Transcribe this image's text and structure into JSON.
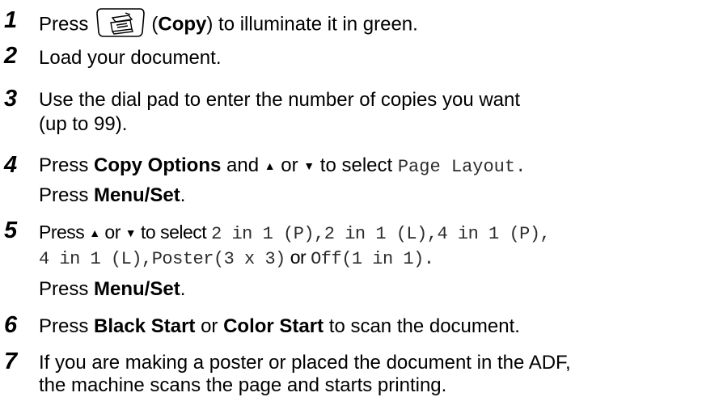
{
  "steps": [
    {
      "number": "1",
      "parts": [
        "Press",
        "(",
        "Copy",
        ") to illuminate it in green."
      ],
      "icon": "copy-key-icon"
    },
    {
      "number": "2",
      "text": "Load your document."
    },
    {
      "number": "3",
      "line1": "Use the dial pad to enter the number of copies you want",
      "line2": "(up to 99)."
    },
    {
      "number": "4",
      "line1_parts": [
        "Press ",
        "Copy Options",
        " and ",
        "▲",
        " or ",
        "▼",
        " to select ",
        "Page Layout",
        "."
      ],
      "line2_parts": [
        "Press ",
        "Menu/Set",
        "."
      ]
    },
    {
      "number": "5",
      "line1_parts": [
        "Press ",
        "▲",
        " or ",
        "▼",
        " to select ",
        "2 in 1 (P),2 in 1 (L),4 in 1 (P),"
      ],
      "line2_parts": [
        "4 in 1 (L),Poster(3 x 3)",
        " or ",
        "Off(1 in 1)",
        "."
      ],
      "line3_parts": [
        "Press ",
        "Menu/Set",
        "."
      ]
    },
    {
      "number": "6",
      "parts": [
        "Press ",
        "Black Start",
        " or ",
        "Color Start",
        " to scan the document."
      ]
    },
    {
      "number": "7",
      "line1": "If you are making a poster or placed the document in the ADF,",
      "line2": "the machine scans the page and starts printing."
    }
  ]
}
